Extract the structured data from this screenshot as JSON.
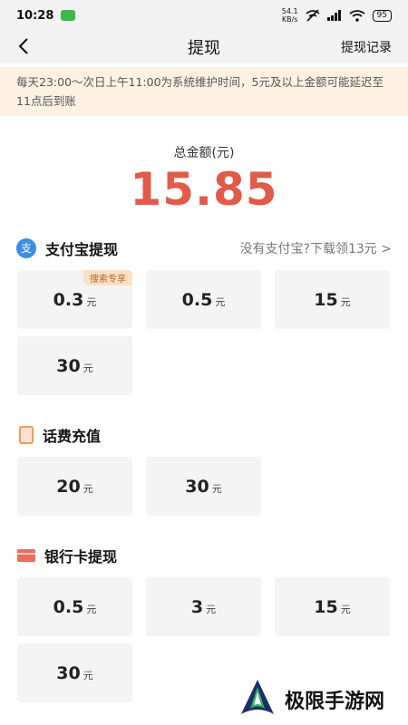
{
  "status_bar": {
    "time": "10:28",
    "net_speed_value": "54.1",
    "net_speed_unit": "KB/s",
    "battery": "95"
  },
  "header": {
    "title": "提现",
    "record_link": "提现记录"
  },
  "notice": "每天23:00～次日上午11:00为系统维护时间，5元及以上金额可能延迟至11点后到账",
  "total": {
    "label": "总金额(元)",
    "amount": "15.85"
  },
  "alipay": {
    "title": "支付宝提现",
    "icon_glyph": "支",
    "link": "没有支付宝?下载领13元 >",
    "options": [
      {
        "value": "0.3",
        "unit": "元",
        "badge": "搜索专享"
      },
      {
        "value": "0.5",
        "unit": "元"
      },
      {
        "value": "15",
        "unit": "元"
      },
      {
        "value": "30",
        "unit": "元"
      }
    ]
  },
  "phone": {
    "title": "话费充值",
    "options": [
      {
        "value": "20",
        "unit": "元"
      },
      {
        "value": "30",
        "unit": "元"
      }
    ]
  },
  "bank": {
    "title": "银行卡提现",
    "options": [
      {
        "value": "0.5",
        "unit": "元"
      },
      {
        "value": "3",
        "unit": "元"
      },
      {
        "value": "15",
        "unit": "元"
      },
      {
        "value": "30",
        "unit": "元"
      }
    ]
  },
  "watermark": {
    "text": "极限手游网"
  },
  "colors": {
    "accent_red": "#e15a4a",
    "notice_bg": "#fdf2e2",
    "alipay_blue": "#3a8ee6"
  }
}
